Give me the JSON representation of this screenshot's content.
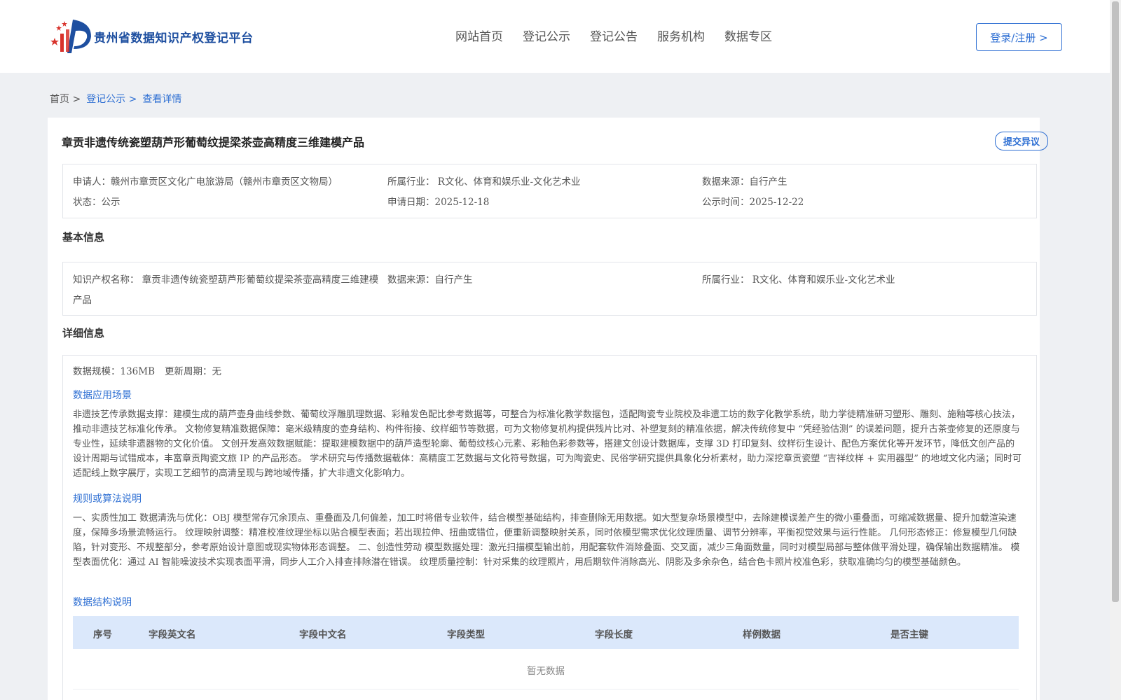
{
  "header": {
    "site_title": "贵州省数据知识产权登记平台",
    "nav": [
      "网站首页",
      "登记公示",
      "登记公告",
      "服务机构",
      "数据专区"
    ],
    "login_label": "登录/注册 >"
  },
  "breadcrumb": [
    "首页 >",
    "登记公示 >",
    "查看详情"
  ],
  "product": {
    "title": "章贡非遗传统瓷塑葫芦形葡萄纹提梁茶壶高精度三维建模产品",
    "objection_label": "提交异议",
    "summary": {
      "applicant": "申请人：赣州市章贡区文化广电旅游局（赣州市章贡区文物局）",
      "industry": "所属行业： R文化、体育和娱乐业-文化艺术业",
      "source": "数据来源：自行产生",
      "status": "状态：公示",
      "apply_date": "申请日期：2025-12-18",
      "publish_date": "公示时间：2025-12-22"
    }
  },
  "basic": {
    "heading": "基本信息",
    "ip_name_line1": "知识产权名称： 章贡非遗传统瓷塑葫芦形葡萄纹提梁茶壶高精度三维建模",
    "ip_name_line2": "产品",
    "source": "数据来源：自行产生",
    "industry": "所属行业： R文化、体育和娱乐业-文化艺术业"
  },
  "detail": {
    "heading": "详细信息",
    "scale": "数据规模：136MB",
    "update_cycle": "更新周期：无",
    "scenario_heading": "数据应用场景",
    "scenario_text": "非遗技艺传承数据支撑：建模生成的葫芦壶身曲线参数、葡萄纹浮雕肌理数据、彩釉发色配比参考数据等，可整合为标准化教学数据包，适配陶瓷专业院校及非遗工坊的数字化教学系统，助力学徒精准研习塑形、雕刻、施釉等核心技法，推动非遗技艺标准化传承。 文物修复精准数据保障：毫米级精度的壶身结构、构件衔接、纹样细节等数据，可为文物修复机构提供残片比对、补塑复刻的精准依据，解决传统修复中 “凭经验估测” 的误差问题，提升古茶壶修复的还原度与专业性，延续非遗器物的文化价值。 文创开发高效数据赋能：提取建模数据中的葫芦造型轮廓、葡萄纹核心元素、彩釉色彩参数等，搭建文创设计数据库，支撑 3D 打印复刻、纹样衍生设计、配色方案优化等开发环节，降低文创产品的设计周期与试错成本，丰富章贡陶瓷文旅 IP 的产品形态。 学术研究与传播数据载体：高精度工艺数据与文化符号数据，可为陶瓷史、民俗学研究提供具象化分析素材，助力深挖章贡瓷塑 “吉祥纹样 + 实用器型” 的地域文化内涵；同时可适配线上数字展厅，实现工艺细节的高清呈现与跨地域传播，扩大非遗文化影响力。",
    "algorithm_heading": "规则或算法说明",
    "algorithm_text": "一、实质性加工 数据清洗与优化：OBJ 模型常存冗余顶点、重叠面及几何偏差，加工时将借专业软件，结合模型基础结构，排查删除无用数据。如大型复杂场景模型中，去除建模误差产生的微小重叠面，可缩减数据量、提升加载渲染速度，保障多场景流畅运行。 纹理映射调整：精准校准纹理坐标以贴合模型表面；若出现拉伸、扭曲或错位，便重新调整映射关系，同时依模型需求优化纹理质量、调节分辨率，平衡视觉效果与运行性能。 几何形态修正：修复模型几何缺陷，针对变形、不规整部分，参考原始设计意图或现实物体形态调整。 二、创造性劳动 模型数据处理：激光扫描模型输出前，用配套软件消除叠面、交叉面，减少三角面数量，同时对模型局部与整体做平滑处理，确保输出数据精准。 模型表面优化：通过 AI 智能噪波技术实现表面平滑，同步人工介入排查排除潜在错误。 纹理质量控制：针对采集的纹理照片，用后期软件消除高光、阴影及多余杂色，结合色卡照片校准色彩，获取准确均匀的模型基础颜色。",
    "structure_heading": "数据结构说明",
    "table_headers": [
      "序号",
      "字段英文名",
      "字段中文名",
      "字段类型",
      "字段长度",
      "样例数据",
      "是否主键"
    ],
    "empty_text": "暂无数据"
  }
}
